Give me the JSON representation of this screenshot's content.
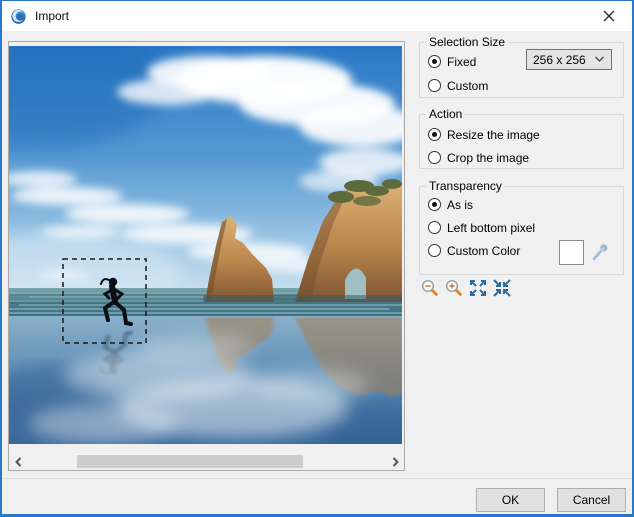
{
  "window": {
    "title": "Import"
  },
  "icons": [
    "app-icon",
    "close-icon",
    "dropdown-chevron-icon",
    "color-picker-icon",
    "zoom-out-icon",
    "zoom-in-icon",
    "zoom-fit-icon",
    "zoom-shrink-icon",
    "scroll-left-icon",
    "scroll-right-icon"
  ],
  "panels": {
    "selection_size": {
      "legend": "Selection Size",
      "options": [
        {
          "label": "Fixed",
          "state": "checked"
        },
        {
          "label": "Custom",
          "state": "unchecked"
        }
      ],
      "size_dropdown": {
        "value": "256 x 256"
      }
    },
    "action": {
      "legend": "Action",
      "options": [
        {
          "label": "Resize the image",
          "state": "checked"
        },
        {
          "label": "Crop the image",
          "state": "unchecked"
        }
      ]
    },
    "transparency": {
      "legend": "Transparency",
      "options": [
        {
          "label": "As is",
          "state": "checked"
        },
        {
          "label": "Left bottom pixel",
          "state": "unchecked"
        },
        {
          "label": "Custom Color",
          "state": "unchecked"
        }
      ],
      "swatch_color": "#ffffff"
    }
  },
  "footer": {
    "ok": "OK",
    "cancel": "Cancel"
  },
  "colors": {
    "accent_border": "#2878c8",
    "dialog_bg": "#f0f0f0",
    "titlebar_bg": "#ffffff"
  }
}
